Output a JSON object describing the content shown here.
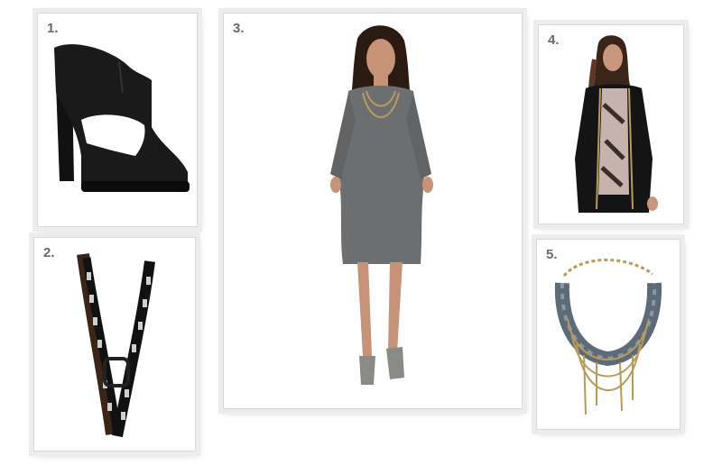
{
  "items": [
    {
      "number": "1.",
      "subject": "black-suede-peep-toe-bootie"
    },
    {
      "number": "2.",
      "subject": "black-studded-skinny-belt"
    },
    {
      "number": "3.",
      "subject": "gray-shirt-dress-model"
    },
    {
      "number": "4.",
      "subject": "black-embellished-cardigan-model"
    },
    {
      "number": "5.",
      "subject": "braided-chain-statement-necklace"
    }
  ],
  "colors": {
    "card_frame": "#ececec",
    "number_text": "#6a6a6a",
    "dress_gray": "#6d6e70",
    "black_item": "#141414",
    "gold_chain": "#b89b5a"
  }
}
